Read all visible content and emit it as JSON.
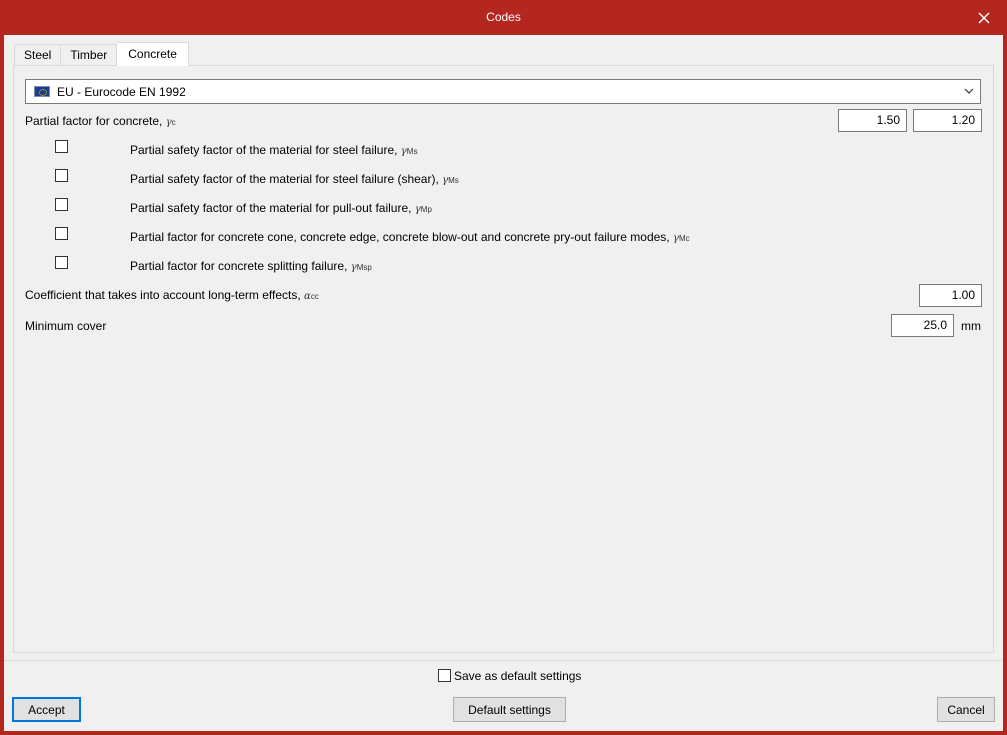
{
  "window": {
    "title": "Codes"
  },
  "tabs": [
    {
      "label": "Steel",
      "active": false
    },
    {
      "label": "Timber",
      "active": false
    },
    {
      "label": "Concrete",
      "active": true
    }
  ],
  "code_select": {
    "value": "EU  -  Eurocode EN 1992",
    "icon": "eu-flag-icon"
  },
  "partial_factor": {
    "label": "Partial factor for concrete, ",
    "symbol": "γ",
    "symbol_sub": "c",
    "value_1": "1.50",
    "value_2": "1.20"
  },
  "checks": [
    {
      "label": "Partial safety factor of the material for steel failure, ",
      "symbol": "γ",
      "sub": "Ms",
      "checked": false
    },
    {
      "label": "Partial safety factor of the material for steel failure (shear), ",
      "symbol": "γ",
      "sub": "Ms",
      "checked": false
    },
    {
      "label": "Partial safety factor of the material for pull-out failure, ",
      "symbol": "γ",
      "sub": "Mp",
      "checked": false
    },
    {
      "label": "Partial factor for concrete cone, concrete edge, concrete blow-out and concrete pry-out failure modes, ",
      "symbol": "γ",
      "sub": "Mc",
      "checked": false
    },
    {
      "label": "Partial factor for concrete splitting failure, ",
      "symbol": "γ",
      "sub": "Msp",
      "checked": false
    }
  ],
  "long_term": {
    "label": "Coefficient that takes into account long-term effects, ",
    "symbol": "α",
    "symbol_sub": "cc",
    "value": "1.00"
  },
  "min_cover": {
    "label": "Minimum cover",
    "value": "25.0",
    "unit": "mm"
  },
  "footer": {
    "save_default_label": "Save as default settings",
    "save_default_checked": false,
    "accept_label": "Accept",
    "default_settings_label": "Default settings",
    "cancel_label": "Cancel"
  },
  "colors": {
    "titlebar": "#b3271f",
    "client_bg": "#f0f0f0",
    "focus_border": "#0078d7"
  }
}
